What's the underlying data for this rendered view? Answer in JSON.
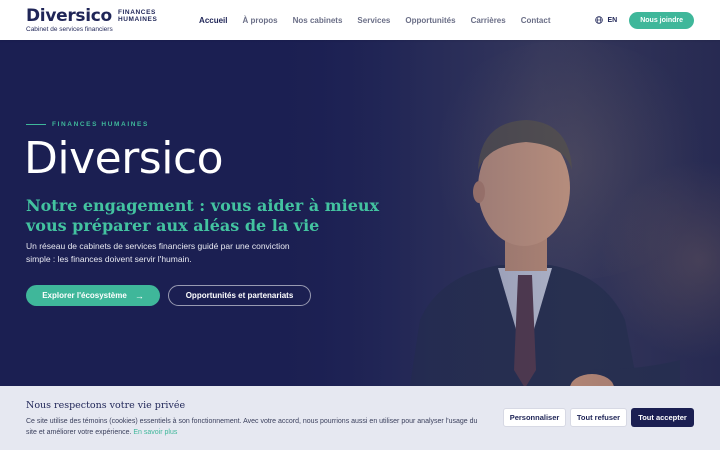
{
  "brand": {
    "name": "Diversico",
    "sub_line1": "FINANCES",
    "sub_line2": "HUMAINES",
    "tagline": "Cabinet de services financiers"
  },
  "nav": {
    "items": [
      {
        "label": "Accueil",
        "active": true
      },
      {
        "label": "À propos"
      },
      {
        "label": "Nos cabinets"
      },
      {
        "label": "Services"
      },
      {
        "label": "Opportunités"
      },
      {
        "label": "Carrières"
      },
      {
        "label": "Contact"
      }
    ],
    "language": "EN",
    "language_icon": "globe-icon",
    "cta": "Nous joindre"
  },
  "hero": {
    "eyebrow": "FINANCES HUMAINES",
    "brand": "Diversico",
    "title": "Notre engagement : vous aider à mieux vous préparer aux aléas de la vie",
    "description": "Un réseau de cabinets de services financiers guidé par une conviction simple : les finances doivent servir l'humain.",
    "primary_button": "Explorer l'écosystème",
    "primary_button_icon": "arrow-right-icon",
    "secondary_button": "Opportunités et partenariats"
  },
  "cookie": {
    "title": "Nous respectons votre vie privée",
    "text": "Ce site utilise des témoins (cookies) essentiels à son fonctionnement. Avec votre accord, nous pourrions aussi en utiliser pour analyser l'usage du site et améliorer votre expérience.",
    "link": "En savoir plus",
    "customize": "Personnaliser",
    "refuse": "Tout refuser",
    "accept": "Tout accepter"
  },
  "colors": {
    "navy": "#1b1f52",
    "accent": "#3fb79a",
    "header_bg": "#ffffff",
    "cookie_bg": "#e6e8f1"
  }
}
